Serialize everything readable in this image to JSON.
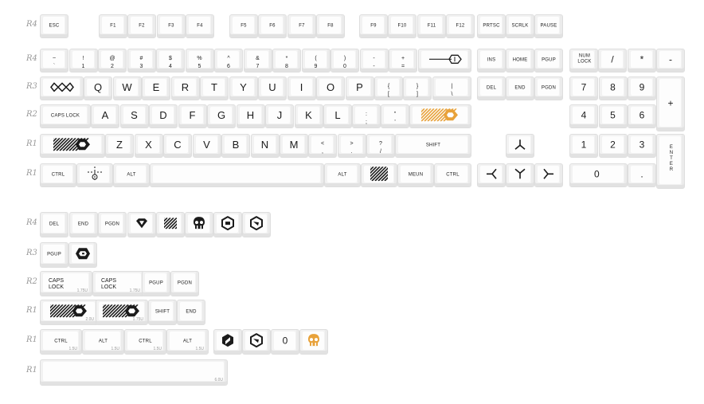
{
  "row_labels": [
    "R4",
    "R4",
    "R3",
    "R2",
    "R1",
    "R1",
    "R4",
    "R3",
    "R2",
    "R1",
    "R1",
    "R1"
  ],
  "colors": {
    "accent": "#e8a23a",
    "dark": "#1b1b1b"
  },
  "keys": {
    "esc": "ESC",
    "f": [
      "F1",
      "F2",
      "F3",
      "F4",
      "F5",
      "F6",
      "F7",
      "F8",
      "F9",
      "F10",
      "F11",
      "F12"
    ],
    "prtsc": "PRTSC",
    "scrlk": "SCRLK",
    "pause": "PAUSE",
    "num_top": [
      "~",
      "!",
      "@",
      "#",
      "$",
      "%",
      "^",
      "&",
      "*",
      "(",
      ")",
      "-",
      "+"
    ],
    "num_bot": [
      "`",
      "1",
      "2",
      "3",
      "4",
      "5",
      "6",
      "7",
      "8",
      "9",
      "0",
      "-",
      "="
    ],
    "ins": "INS",
    "home": "HOME",
    "pgup": "PGUP",
    "numlock": "NUM LOCK",
    "np_slash": "/",
    "np_star": "*",
    "np_minus": "-",
    "qwerty": [
      "Q",
      "W",
      "E",
      "R",
      "T",
      "Y",
      "U",
      "I",
      "O",
      "P"
    ],
    "bracket_top": [
      "{",
      "}",
      "|"
    ],
    "bracket_bot": [
      "[",
      "]",
      "\\"
    ],
    "del": "DEL",
    "end": "END",
    "pgdn": "PGDN",
    "np_row3": [
      "7",
      "8",
      "9"
    ],
    "np_plus": "+",
    "caps": "CAPS LOCK",
    "asdf": [
      "A",
      "S",
      "D",
      "F",
      "G",
      "H",
      "J",
      "K",
      "L"
    ],
    "semi_top": [
      ":",
      "\""
    ],
    "semi_bot": [
      ";",
      "'"
    ],
    "np_row2": [
      "4",
      "5",
      "6"
    ],
    "zxcv": [
      "Z",
      "X",
      "C",
      "V",
      "B",
      "N",
      "M"
    ],
    "comma_top": [
      "<",
      ">",
      "?"
    ],
    "comma_bot": [
      ",",
      ".",
      "/"
    ],
    "shift": "SHIFT",
    "np_row1": [
      "1",
      "2",
      "3"
    ],
    "np_enter": "ENTER",
    "ctrl": "CTRL",
    "alt": "ALT",
    "meun": "MEUN",
    "np_zero": "0",
    "np_dot": "."
  },
  "extras": {
    "r4": [
      "DEL",
      "END",
      "PGDN"
    ],
    "r3": [
      "PGUP"
    ],
    "r2_caps": "CAPS LOCK",
    "r2_size": "1.75U",
    "r2_pgup": "PGUP",
    "r2_pgdn": "PGDN",
    "r1_sizes": [
      "2.0U",
      "1.75U"
    ],
    "r1_shift": "SHIFT",
    "r1_end": "END",
    "r0_labels": [
      "CTRL",
      "ALT",
      "CTRL",
      "ALT"
    ],
    "r0_size": "1.5U",
    "r0_zero": "0",
    "space_size": "6.0U"
  }
}
